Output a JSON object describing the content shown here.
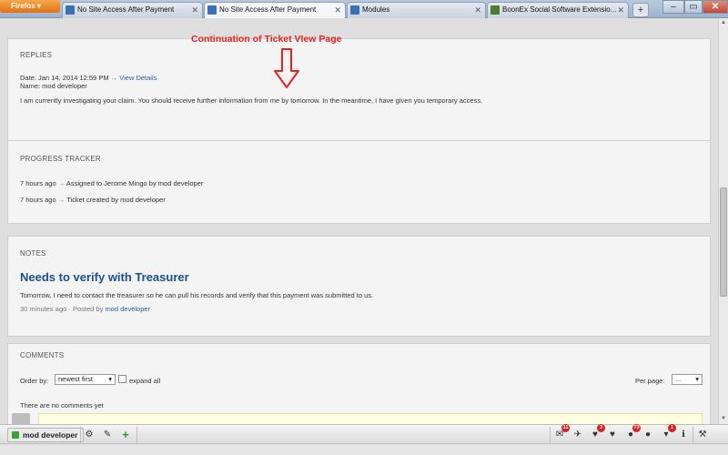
{
  "browser": {
    "menu_button": "Firefox",
    "tabs": [
      {
        "title": "No Site Access After Payment",
        "active": false,
        "favicon_color": "#3b6fb6"
      },
      {
        "title": "No Site Access After Payment",
        "active": true,
        "favicon_color": "#3b6fb6"
      },
      {
        "title": "Modules",
        "active": false,
        "favicon_color": "#3b6fb6"
      },
      {
        "title": "BoonEx Social Software Extensio...",
        "active": false,
        "favicon_color": "#4d7c2f"
      }
    ],
    "new_tab_icon": "+",
    "window_controls": {
      "minimize": "–",
      "restore": "▭",
      "close": "✕"
    }
  },
  "annotation": {
    "text": "Continuation of Ticket VIew Page",
    "color": "#e8211d"
  },
  "replies": {
    "title": "REPLIES",
    "date": "Date: Jan 14, 2014 12:59 PM",
    "arrow": "→",
    "view_details": "View Details",
    "name": "Name: mod developer",
    "message": "I am currently investigating your claim. You should receive further information from me by tomorrow. In the meantime, I have given you temporary access."
  },
  "progress": {
    "title": "PROGRESS TRACKER",
    "entries": [
      {
        "time": "7 hours ago",
        "arrow": "→",
        "text": "Assigned to Jerome Mingo by mod developer"
      },
      {
        "time": "7 hours ago",
        "arrow": "→",
        "text": "Ticket created by mod developer"
      }
    ]
  },
  "notes": {
    "title": "NOTES",
    "note_title": "Needs to verify with Treasurer",
    "body": "Tomorrow, I need to contact the treasurer so he can pull his records and verify that this payment was submitted to us.",
    "meta_time": "30 minutes ago",
    "meta_sep": "·",
    "meta_posted": "Posted by",
    "meta_author": "mod developer"
  },
  "comments": {
    "title": "COMMENTS",
    "order_label": "Order by:",
    "order_value": "newest first",
    "expand_all": "expand all",
    "per_page_label": "Per page:",
    "per_page_value": "...",
    "empty_text": "There are no comments yet"
  },
  "toolbar": {
    "user_name": "mod developer",
    "user_status_color": "#34a534",
    "left_icons": [
      "gear-icon",
      "edit-icon",
      "add-icon"
    ],
    "right_icons": [
      {
        "name": "mail-icon",
        "glyph": "✉",
        "badge": "11"
      },
      {
        "name": "twitter-icon",
        "glyph": "🐦",
        "badge": ""
      },
      {
        "name": "heart-icon",
        "glyph": "♥",
        "badge": "3"
      },
      {
        "name": "heart-outline-icon",
        "glyph": "♥",
        "badge": ""
      },
      {
        "name": "friends-icon",
        "glyph": "👥",
        "badge": "73"
      },
      {
        "name": "person-icon",
        "glyph": "👤",
        "badge": ""
      },
      {
        "name": "cart-icon",
        "glyph": "🛒",
        "badge": "1"
      },
      {
        "name": "info-icon",
        "glyph": "ℹ",
        "badge": ""
      },
      {
        "name": "wrench-icon",
        "glyph": "🔧",
        "badge": ""
      }
    ]
  }
}
